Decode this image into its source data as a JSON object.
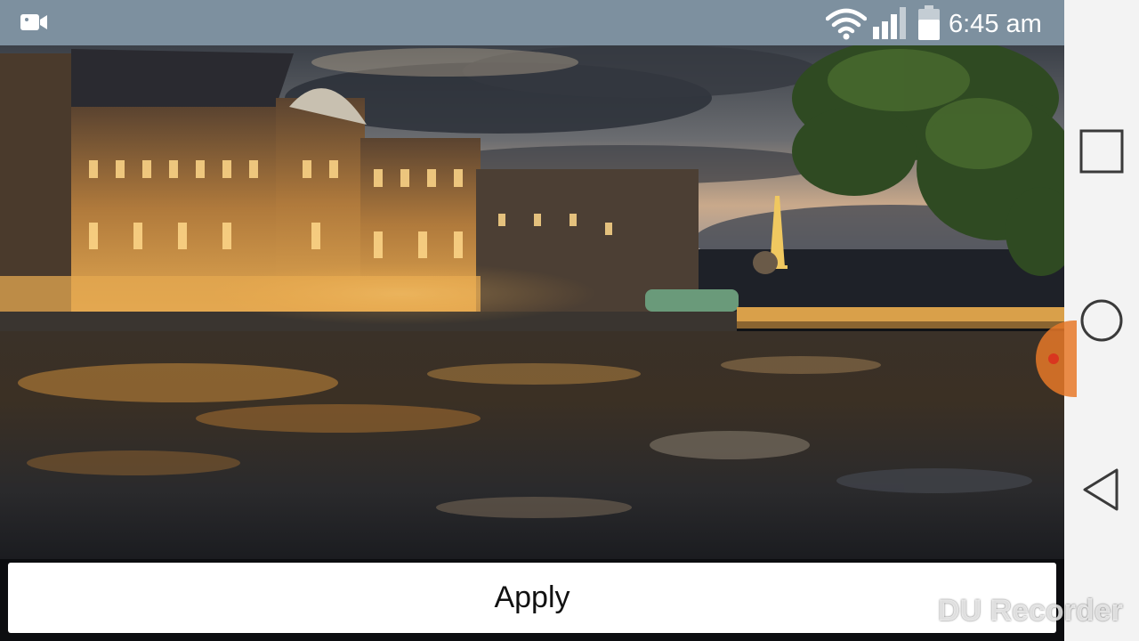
{
  "status_bar": {
    "time": "6:45 am",
    "icons": [
      "video-camera-icon",
      "wifi-icon",
      "cell-signal-icon",
      "battery-icon"
    ],
    "color": "#7d909f"
  },
  "preview": {
    "description_icon": "wallpaper-preview"
  },
  "apply_button": {
    "label": "Apply"
  },
  "nav_bar": {
    "items": [
      "recent-apps-icon",
      "home-icon",
      "back-icon"
    ],
    "color": "#f3f3f3"
  },
  "watermark": {
    "text": "DU Recorder",
    "icon": "video-camera-icon"
  },
  "colors": {
    "accent_orange": "#e67828",
    "record_red": "#d9361f"
  }
}
